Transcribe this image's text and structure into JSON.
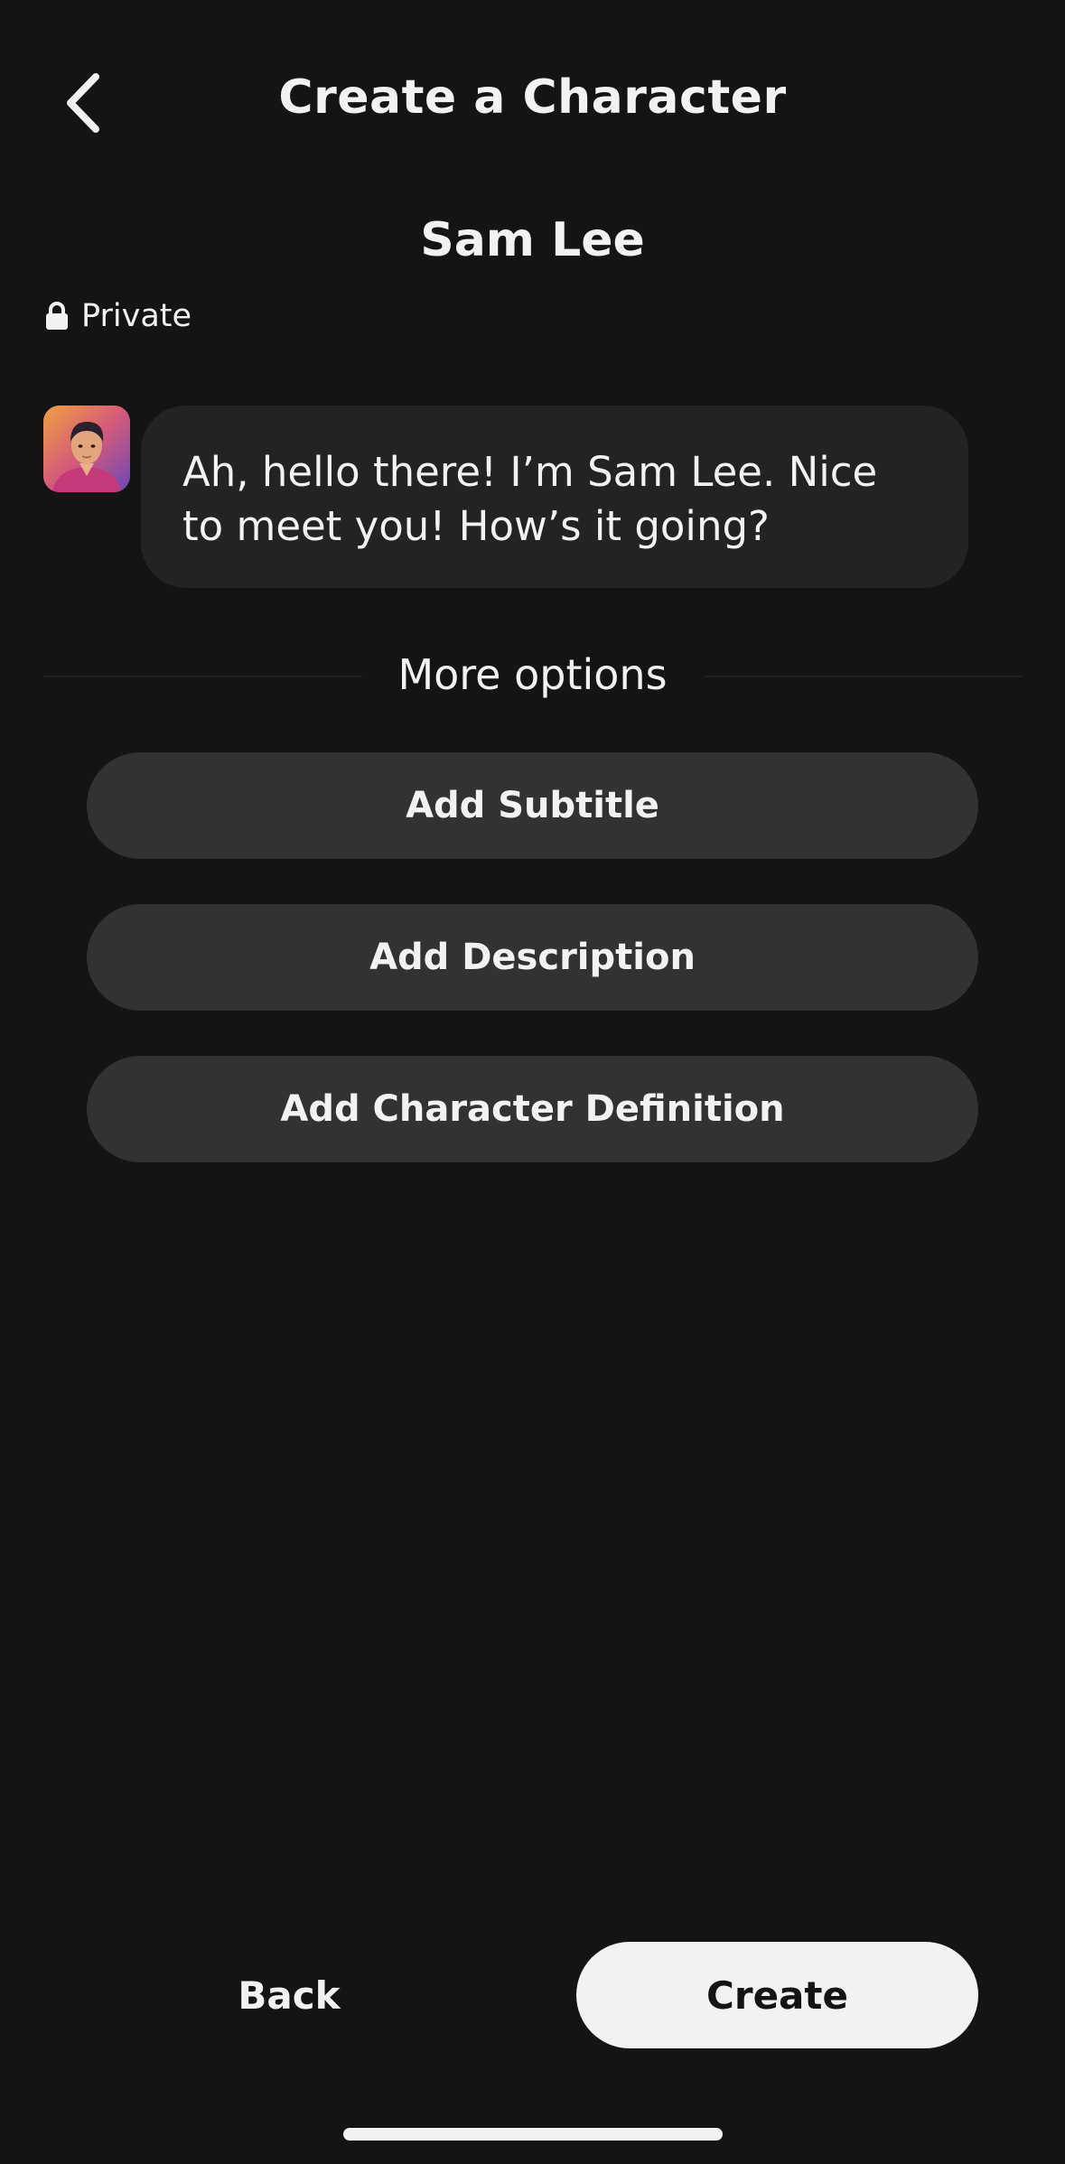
{
  "header": {
    "title": "Create a Character",
    "back_icon": "chevron-left-icon"
  },
  "character": {
    "name": "Sam Lee",
    "visibility_label": "Private",
    "visibility_icon": "lock-icon",
    "greeting": "Ah, hello there! I’m Sam Lee. Nice to meet you! How’s it going?"
  },
  "more_options": {
    "label": "More options",
    "buttons": [
      {
        "label": "Add Subtitle"
      },
      {
        "label": "Add Description"
      },
      {
        "label": "Add Character Definition"
      }
    ]
  },
  "footer": {
    "back_label": "Back",
    "create_label": "Create"
  },
  "colors": {
    "background": "#141414",
    "bubble": "#232323",
    "option_button": "#323232",
    "primary_button": "#f2f2f2",
    "text": "#f2f2f2"
  }
}
